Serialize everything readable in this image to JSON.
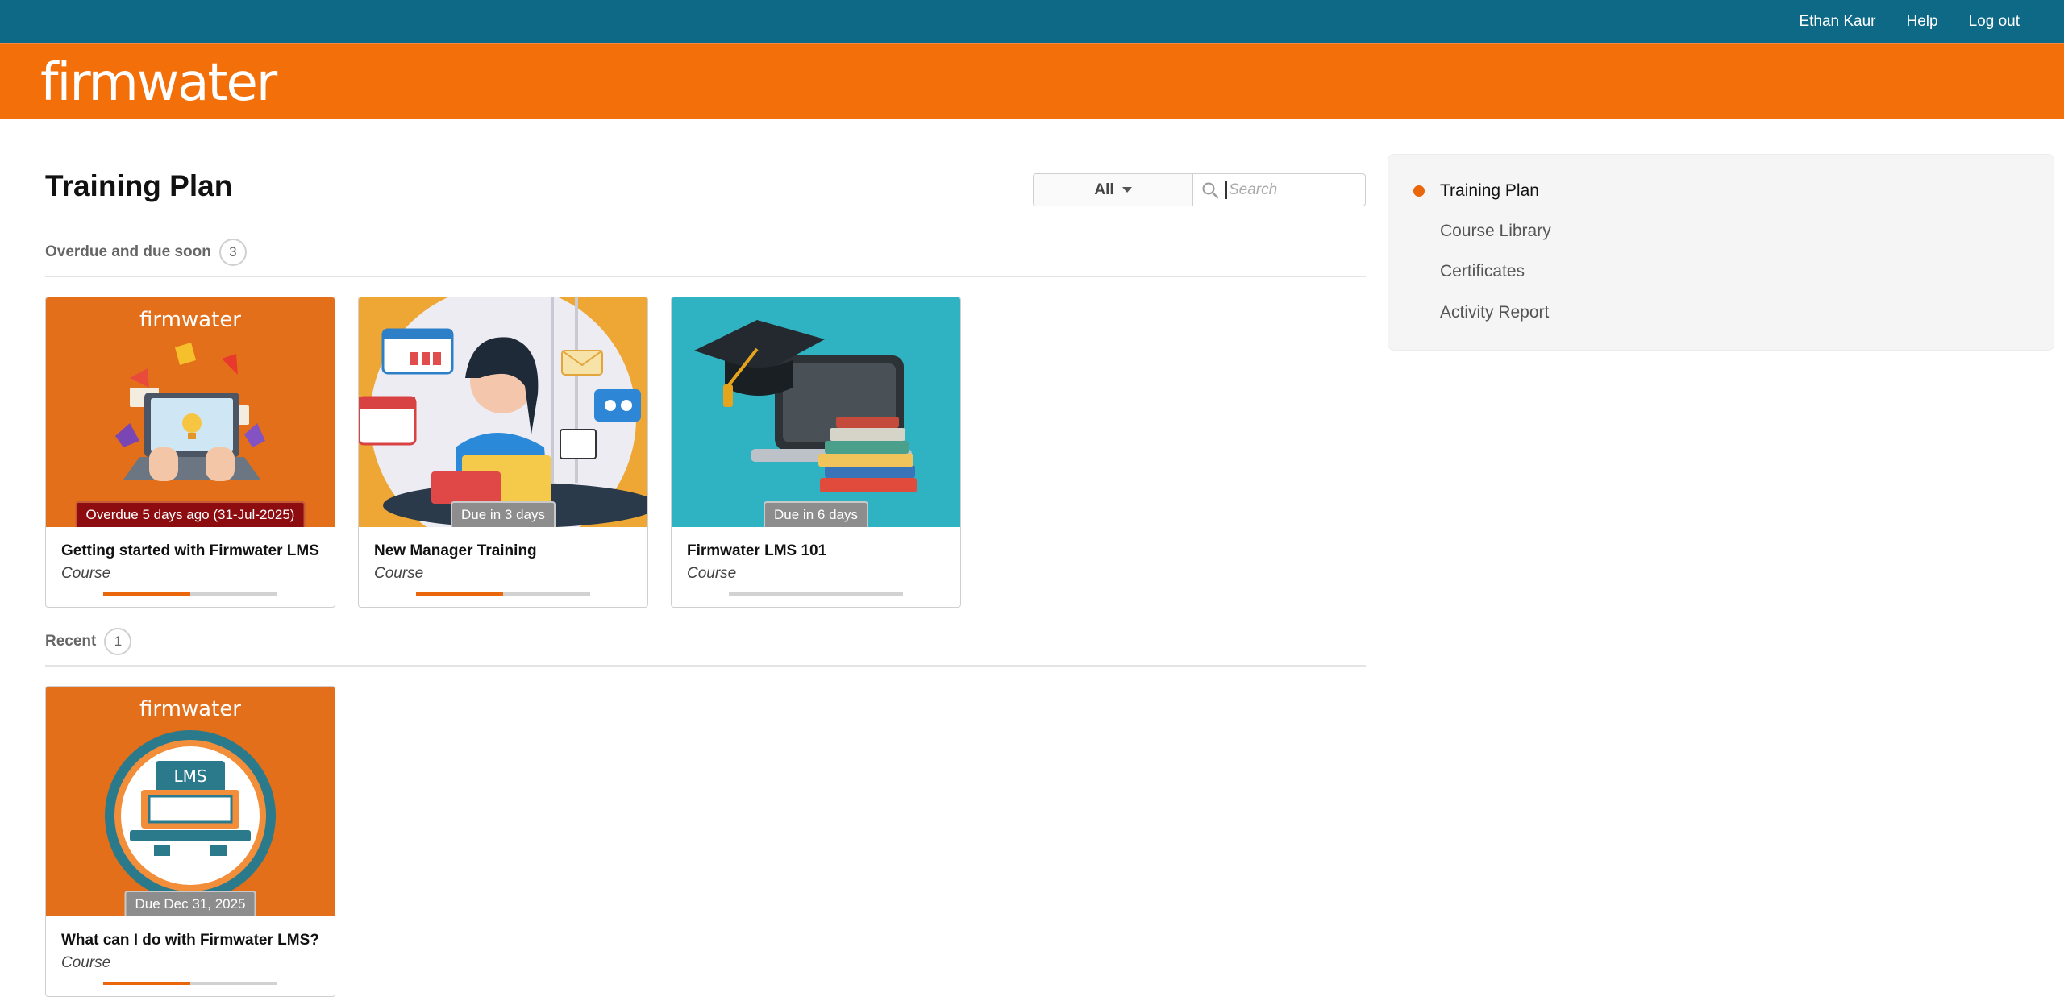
{
  "header": {
    "user_name": "Ethan Kaur",
    "help": "Help",
    "logout": "Log out",
    "logo_text": "firmwater",
    "bar_color": "#0d6986",
    "brand_color": "#f36f09"
  },
  "main": {
    "title": "Training Plan",
    "filter": {
      "selected": "All",
      "search_placeholder": "Search"
    }
  },
  "sections": [
    {
      "label": "Overdue and due soon",
      "count": "3",
      "cards": [
        {
          "title": "Getting started with Firmwater LMS",
          "type": "Course",
          "badge": "Overdue 5 days ago (31-Jul-2025)",
          "badge_status": "overdue",
          "progress": 0.5,
          "thumb_logo": "firmwater"
        },
        {
          "title": "New Manager Training",
          "type": "Course",
          "badge": "Due in 3 days",
          "badge_status": "due",
          "progress": 0.5
        },
        {
          "title": "Firmwater LMS 101",
          "type": "Course",
          "badge": "Due in 6 days",
          "badge_status": "due",
          "progress": 0
        }
      ]
    },
    {
      "label": "Recent",
      "count": "1",
      "cards": [
        {
          "title": "What can I do with Firmwater LMS?",
          "type": "Course",
          "badge": "Due Dec 31, 2025",
          "badge_status": "due",
          "progress": 0.5,
          "thumb_logo": "firmwater",
          "thumb_text": "LMS"
        }
      ]
    }
  ],
  "sidebar": {
    "items": [
      {
        "label": "Training Plan",
        "active": true
      },
      {
        "label": "Course Library"
      },
      {
        "label": "Certificates"
      },
      {
        "label": "Activity Report"
      }
    ]
  }
}
